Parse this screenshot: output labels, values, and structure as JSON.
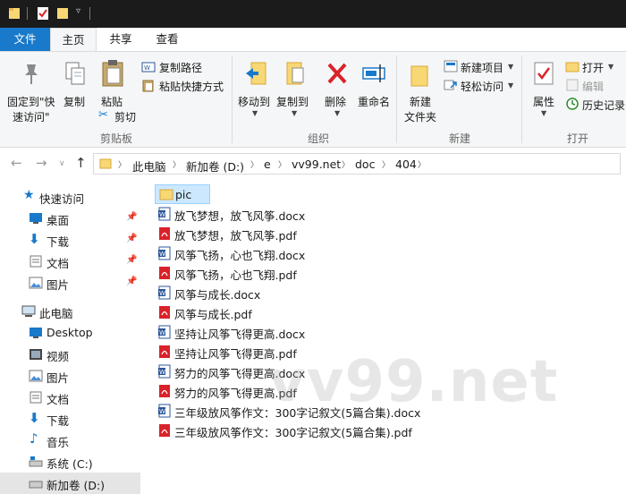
{
  "tabs": {
    "file": "文件",
    "home": "主页",
    "share": "共享",
    "view": "查看"
  },
  "ribbon": {
    "pin_quick": [
      "固定到\"快",
      "速访问\""
    ],
    "copy": "复制",
    "paste": "粘贴",
    "copy_path": "复制路径",
    "paste_shortcut": "粘贴快捷方式",
    "cut": "剪切",
    "move_to": "移动到",
    "copy_to": "复制到",
    "delete": "删除",
    "rename": "重命名",
    "new_folder": [
      "新建",
      "文件夹"
    ],
    "new_item": "新建项目",
    "easy_access": "轻松访问",
    "properties": "属性",
    "open": "打开",
    "edit": "编辑",
    "history": "历史记录",
    "groups": {
      "clipboard": "剪贴板",
      "organize": "组织",
      "new": "新建",
      "open": "打开"
    }
  },
  "breadcrumb": [
    "此电脑",
    "新加卷 (D:)",
    "e",
    "vv99.net",
    "doc",
    "404"
  ],
  "navpane": {
    "quick_access": "快速访问",
    "quick_items": [
      "桌面",
      "下载",
      "文档",
      "图片"
    ],
    "this_pc": "此电脑",
    "pc_items": [
      "Desktop",
      "视频",
      "图片",
      "文档",
      "下载",
      "音乐",
      "系统 (C:)",
      "新加卷 (D:)"
    ]
  },
  "files": [
    {
      "name": "pic",
      "type": "folder"
    },
    {
      "name": "放飞梦想，放飞风筝.docx",
      "type": "docx"
    },
    {
      "name": "放飞梦想，放飞风筝.pdf",
      "type": "pdf"
    },
    {
      "name": "风筝飞扬，心也飞翔.docx",
      "type": "docx"
    },
    {
      "name": "风筝飞扬，心也飞翔.pdf",
      "type": "pdf"
    },
    {
      "name": "风筝与成长.docx",
      "type": "docx"
    },
    {
      "name": "风筝与成长.pdf",
      "type": "pdf"
    },
    {
      "name": "坚持让风筝飞得更高.docx",
      "type": "docx"
    },
    {
      "name": "坚持让风筝飞得更高.pdf",
      "type": "pdf"
    },
    {
      "name": "努力的风筝飞得更高.docx",
      "type": "docx"
    },
    {
      "name": "努力的风筝飞得更高.pdf",
      "type": "pdf"
    },
    {
      "name": "三年级放风筝作文：300字记叙文(5篇合集).docx",
      "type": "docx"
    },
    {
      "name": "三年级放风筝作文：300字记叙文(5篇合集).pdf",
      "type": "pdf"
    }
  ],
  "watermark": "vv99.net",
  "colors": {
    "accent": "#1979ca",
    "selection": "#cce8ff",
    "folder": "#f8d775",
    "pdf": "#d9222a",
    "word": "#2b579a"
  }
}
